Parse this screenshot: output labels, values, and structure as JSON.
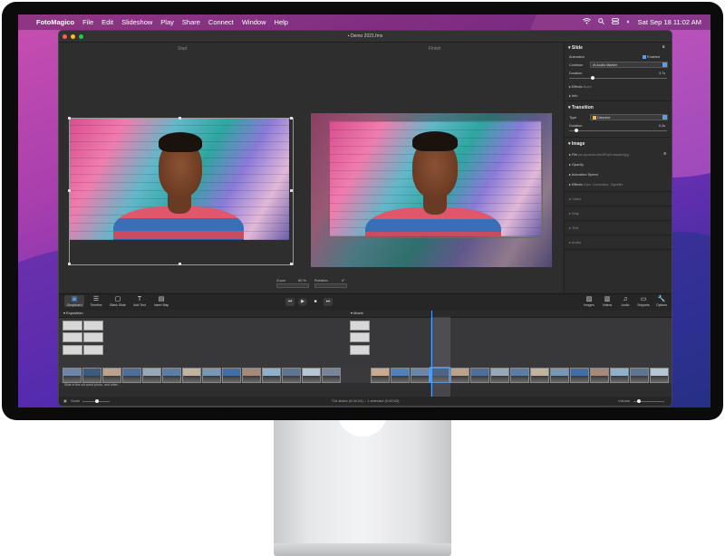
{
  "menubar": {
    "app": "FotoMagico",
    "items": [
      "File",
      "Edit",
      "Slideshow",
      "Play",
      "Share",
      "Connect",
      "Window",
      "Help"
    ],
    "clock": "Sat Sep 18  11:02 AM"
  },
  "window": {
    "title": "Demo 2021.fmx"
  },
  "stage": {
    "start_label": "Start",
    "finish_label": "Finish",
    "zoom_label": "Zoom",
    "zoom_value": "80 %",
    "rotation_label": "Rotation",
    "rotation_value": "0°"
  },
  "inspector": {
    "slide": {
      "title": "Slide",
      "animation_label": "Animation",
      "animation_value": "Enabled",
      "continue_label": "Continue",
      "continue_value": "At Audio Marker",
      "duration_label": "Duration",
      "duration_value": "3,7s",
      "effects_label": "Effects",
      "effects_value": "None",
      "info_label": "Info"
    },
    "transition": {
      "title": "Transition",
      "type_label": "Type",
      "type_value": "Dissolve",
      "duration_label": "Duration",
      "duration_value": "0,3s"
    },
    "image": {
      "title": "Image",
      "file_label": "File",
      "file_value": "joe-ogunsola-ulthv3RVqM-unsplash.jpg",
      "opacity_label": "Opacity",
      "anim_speed_label": "Animation Speed",
      "effects_label": "Effects",
      "effects_value": "Color Correction, Vignette"
    },
    "collapsed": [
      "Video",
      "Map",
      "Text",
      "Audio"
    ]
  },
  "toolbar": {
    "left": [
      "Storyboard",
      "Timeline",
      "Blank Slide",
      "Add Text",
      "Insert Map"
    ],
    "right": [
      "Images",
      "Videos",
      "Audio",
      "Snippets",
      "Options"
    ]
  },
  "timeline": {
    "track1_label": "Exposition",
    "track2_label": "Movie",
    "caption": "Slide in the old world photo, and other..."
  },
  "status": {
    "scale_label": "Scale",
    "center": "716 slides (0:04:24) – 1 selected (0:00:03)",
    "volume_label": "Volume"
  },
  "colors": {
    "accent": "#4ea0ff",
    "window_bg": "#2a2a2b",
    "desktop_top": "#c84fb0",
    "desktop_bottom": "#22307a"
  }
}
